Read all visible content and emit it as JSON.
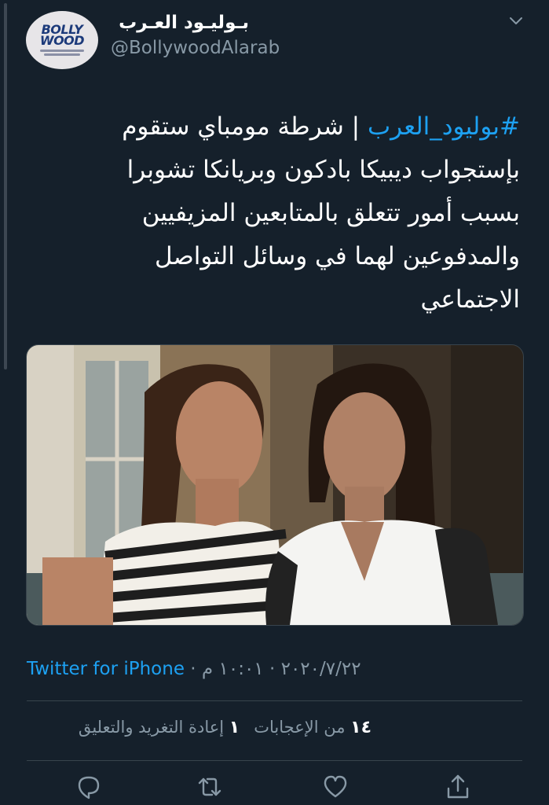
{
  "author": {
    "display_name": "بـوليـود العـرب",
    "handle": "@BollywoodAlarab",
    "avatar_logo": {
      "line1": "BOLLY",
      "line2": "WOOD",
      "brand_color": "#1c3a7a"
    }
  },
  "tweet": {
    "hashtag": "#بوليود_العرب",
    "separator": " | ",
    "body": "شرطة مومباي ستقوم بإستجواب ديبيكا بادكون وبريانكا تشوبرا بسبب أمور تتعلق بالمتابعين المزيفيين والمدفوعين لهما في وسائل التواصل الاجتماعي"
  },
  "meta": {
    "time": "١٠:٠١ م",
    "date": "٢٠٢٠/٧/٢٢",
    "source": "Twitter for iPhone",
    "dot": " · "
  },
  "stats": {
    "likes_count": "١٤",
    "likes_label": "من الإعجابات",
    "retweets_count": "١",
    "retweets_label": "إعادة التغريد والتعليق"
  },
  "actions": [
    "reply-icon",
    "retweet-icon",
    "like-icon",
    "share-icon"
  ],
  "colors": {
    "background": "#15202b",
    "accent": "#1da1f2",
    "secondary_text": "#8899a6",
    "divider": "#38444d"
  }
}
